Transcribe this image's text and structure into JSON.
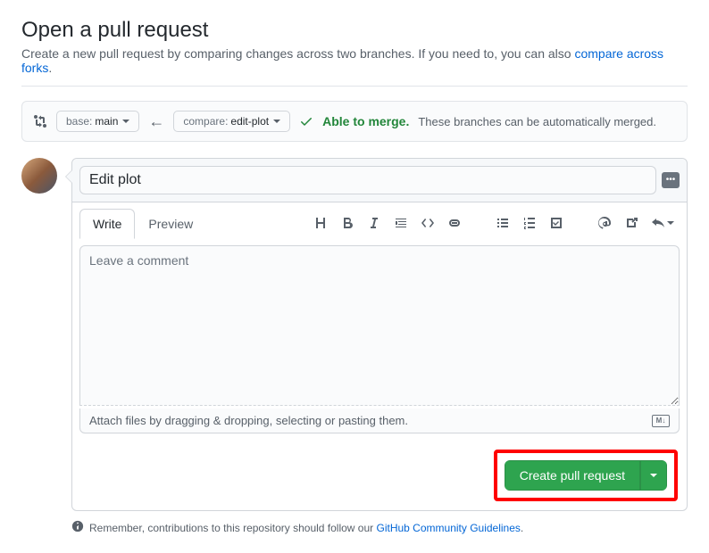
{
  "header": {
    "title": "Open a pull request",
    "subtitle_prefix": "Create a new pull request by comparing changes across two branches. If you need to, you can also ",
    "compare_link": "compare across forks",
    "subtitle_suffix": "."
  },
  "compare": {
    "base_label": "base: ",
    "base_branch": "main",
    "compare_label": "compare: ",
    "compare_branch": "edit-plot",
    "merge_ok": "Able to merge.",
    "merge_text": "These branches can be automatically merged."
  },
  "form": {
    "title_value": "Edit plot",
    "tab_write": "Write",
    "tab_preview": "Preview",
    "comment_placeholder": "Leave a comment",
    "attach_text": "Attach files by dragging & dropping, selecting or pasting them.",
    "submit_label": "Create pull request"
  },
  "footer": {
    "prefix": "Remember, contributions to this repository should follow our ",
    "link": "GitHub Community Guidelines",
    "suffix": "."
  }
}
